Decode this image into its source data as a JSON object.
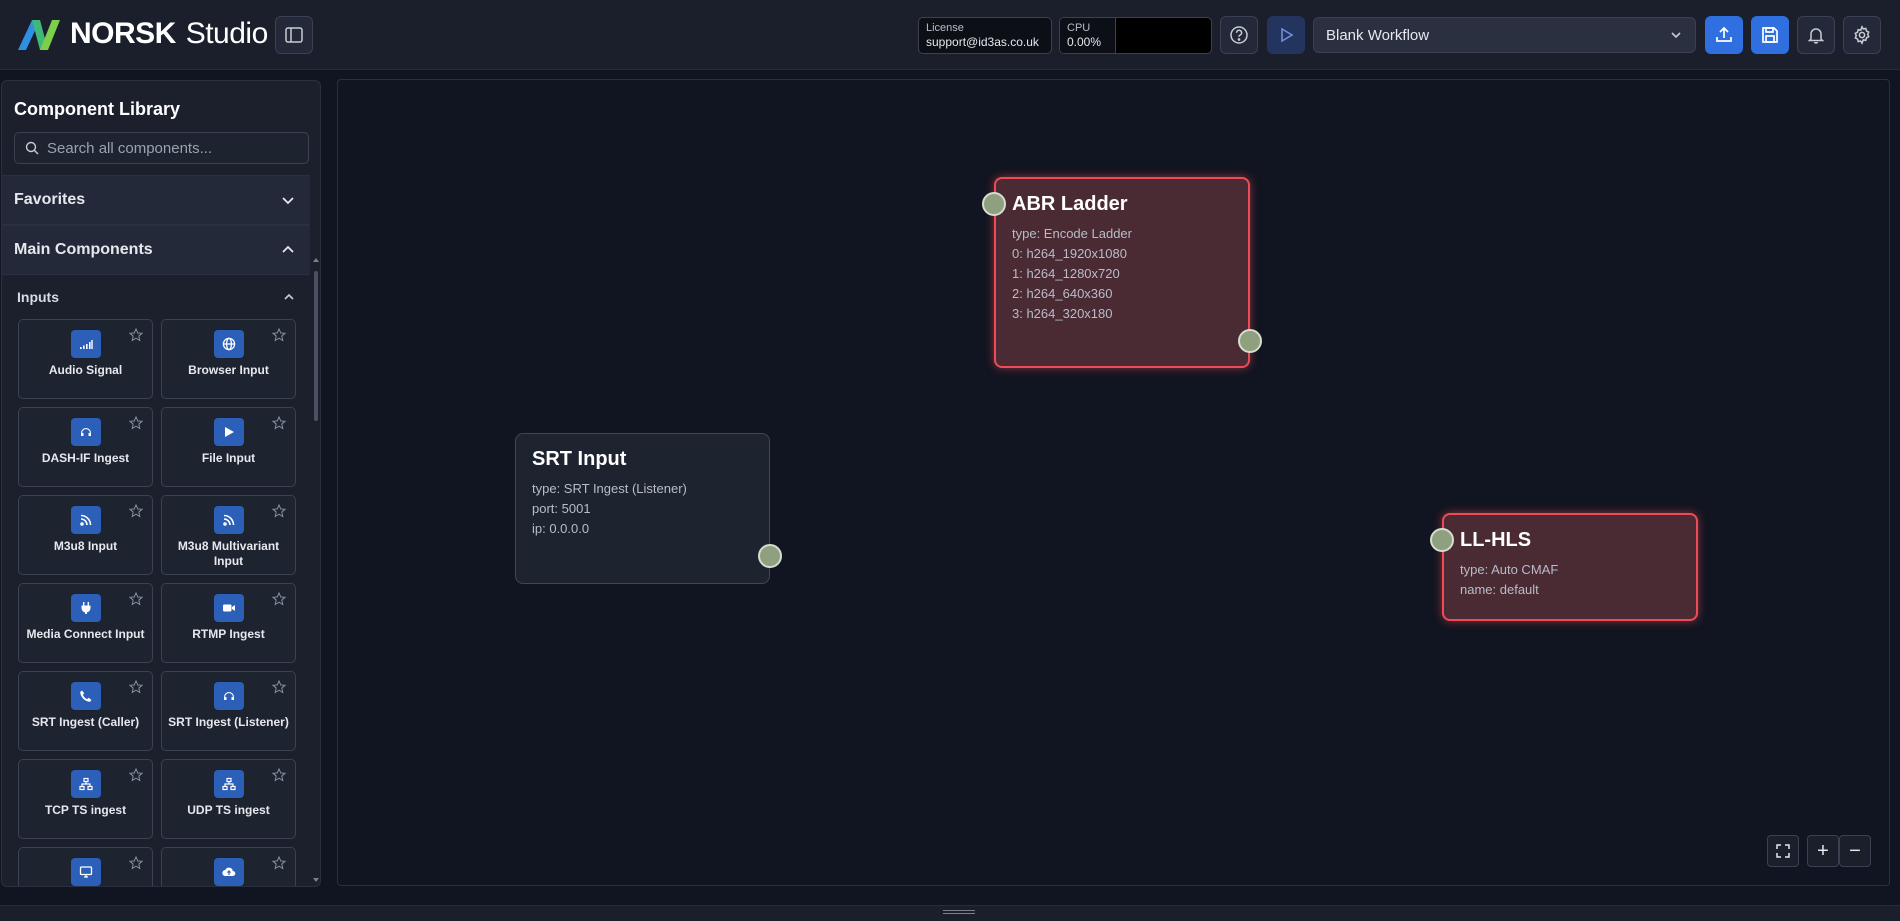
{
  "app": {
    "logo_brand": "NORSK",
    "logo_product": "Studio"
  },
  "topbar": {
    "license_label": "License",
    "license_value": "support@id3as.co.uk",
    "cpu_label": "CPU",
    "cpu_value": "0.00%",
    "workflow_selected": "Blank Workflow",
    "accent_color": "#2f6fe0"
  },
  "sidebar": {
    "title": "Component Library",
    "search_placeholder": "Search all components...",
    "sections": {
      "favorites": "Favorites",
      "main": "Main Components",
      "inputs": "Inputs"
    },
    "components": [
      {
        "name": "Audio Signal",
        "icon": "signal-icon"
      },
      {
        "name": "Browser Input",
        "icon": "globe-icon"
      },
      {
        "name": "DASH-IF Ingest",
        "icon": "headphones-icon"
      },
      {
        "name": "File Input",
        "icon": "play-icon"
      },
      {
        "name": "M3u8 Input",
        "icon": "rss-icon"
      },
      {
        "name": "M3u8 Multivariant Input",
        "icon": "rss-icon"
      },
      {
        "name": "Media Connect Input",
        "icon": "plug-icon"
      },
      {
        "name": "RTMP Ingest",
        "icon": "video-icon"
      },
      {
        "name": "SRT Ingest (Caller)",
        "icon": "phone-icon"
      },
      {
        "name": "SRT Ingest (Listener)",
        "icon": "headphones-icon"
      },
      {
        "name": "TCP TS ingest",
        "icon": "network-icon"
      },
      {
        "name": "UDP TS ingest",
        "icon": "network-icon"
      }
    ]
  },
  "canvas": {
    "nodes": {
      "abr": {
        "title": "ABR Ladder",
        "lines": [
          "type: Encode Ladder",
          "0: h264_1920x1080",
          "1: h264_1280x720",
          "2: h264_640x360",
          "3: h264_320x180"
        ]
      },
      "srt": {
        "title": "SRT Input",
        "lines": [
          "type: SRT Ingest (Listener)",
          "port: 5001",
          "ip: 0.0.0.0"
        ]
      },
      "llhls": {
        "title": "LL-HLS",
        "lines": [
          "type: Auto CMAF",
          "name: default"
        ]
      }
    },
    "zoom_in_label": "+",
    "zoom_out_label": "−",
    "error_color": "#ef4b55"
  }
}
